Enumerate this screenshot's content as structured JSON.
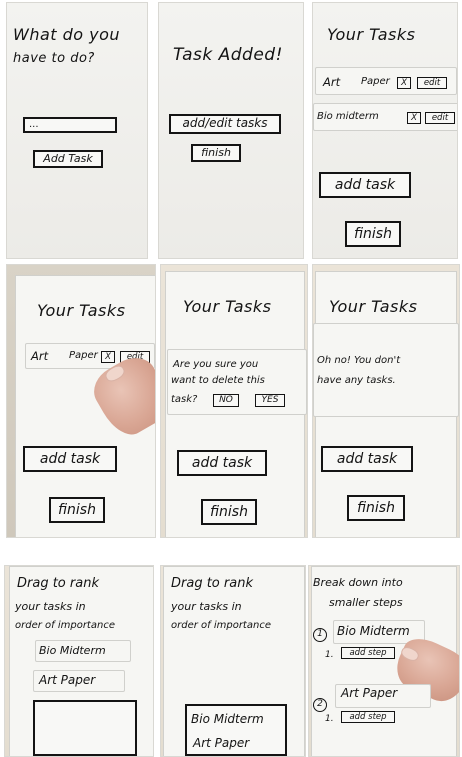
{
  "p1": {
    "title_line1": "What do you",
    "title_line2": "have to do?",
    "input_value": "...",
    "add_task": "Add Task"
  },
  "p2": {
    "title": "Task Added!",
    "add_edit": "add/edit tasks",
    "finish": "finish"
  },
  "p3": {
    "title": "Your Tasks",
    "task1": "Art",
    "task1b": "Paper",
    "x": "X",
    "edit": "edit",
    "task2": "Bio midterm",
    "add_task": "add task",
    "finish": "finish"
  },
  "p4": {
    "title": "Your Tasks",
    "task1": "Art",
    "task1b": "Paper",
    "x": "X",
    "edit": "edit",
    "add_task": "add task",
    "finish": "finish"
  },
  "p5": {
    "title": "Your Tasks",
    "confirm_line1": "Are you sure you",
    "confirm_line2": "want to delete this",
    "confirm_line3": "task?",
    "no": "NO",
    "yes": "YES",
    "add_task": "add task",
    "finish": "finish"
  },
  "p6": {
    "title": "Your Tasks",
    "empty_line1": "Oh no! You don't",
    "empty_line2": "have any tasks.",
    "add_task": "add task",
    "finish": "finish"
  },
  "p7": {
    "line1": "Drag to rank",
    "line2": "your tasks in",
    "line3": "order of importance",
    "item1": "Bio Midterm",
    "item2": "Art Paper"
  },
  "p8": {
    "line1": "Drag to rank",
    "line2": "your tasks in",
    "line3": "order of importance",
    "item1": "Bio Midterm",
    "item2": "Art Paper"
  },
  "p9": {
    "line1": "Break down into",
    "line2": "smaller steps",
    "n1": "1",
    "task1": "Bio Midterm",
    "sub1": "1.",
    "add_step": "add step",
    "n2": "2",
    "task2": "Art Paper",
    "sub2": "1.",
    "add_step2": "add step"
  }
}
